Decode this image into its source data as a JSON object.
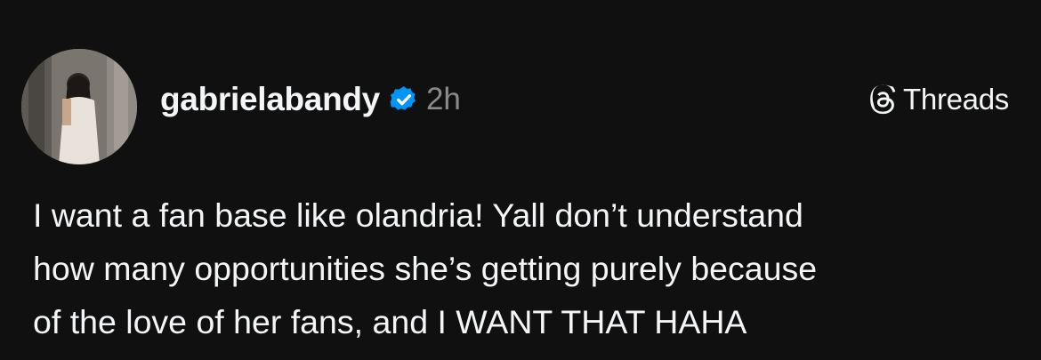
{
  "post": {
    "author": {
      "username": "gabrielabandy",
      "verified": true,
      "avatar": "profile-photo"
    },
    "timestamp": "2h",
    "brand": {
      "icon": "threads-logo-icon",
      "label": "Threads"
    },
    "text_lines": [
      "I want a fan base like olandria! Yall don’t understand",
      "how many opportunities she’s getting purely because",
      "of the love of her fans, and I WANT THAT HAHA"
    ]
  },
  "colors": {
    "background": "#101010",
    "text": "#f3f5f7",
    "muted": "#8a8a8a",
    "verified_badge": "#0095f6"
  }
}
